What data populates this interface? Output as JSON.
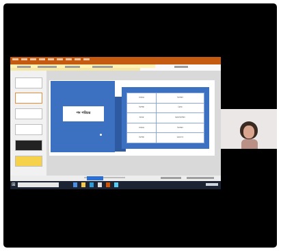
{
  "meeting": {
    "window": "video-meeting",
    "shared_screen": {
      "app": "presentation-editor",
      "slide": {
        "title": "পদ পরিচয়",
        "table": [
          [
            "সর্বনাম",
            "বিশেষণ"
          ],
          [
            "বিশেষ্য",
            "ক্রিয়া"
          ],
          [
            "অব্যয়",
            "ক্রিয়াবিশেষণ"
          ],
          [
            "সর্বনাম",
            "বিশেষণ"
          ],
          [
            "বিশেষ্য",
            "ক্রিয়াপদ"
          ]
        ]
      }
    },
    "participant": {
      "label": "webcam-participant"
    }
  },
  "colors": {
    "ribbon": "#c55a11",
    "slide_blue": "#3c71c2",
    "taskbar": "#1c2433",
    "background": "#000000"
  }
}
